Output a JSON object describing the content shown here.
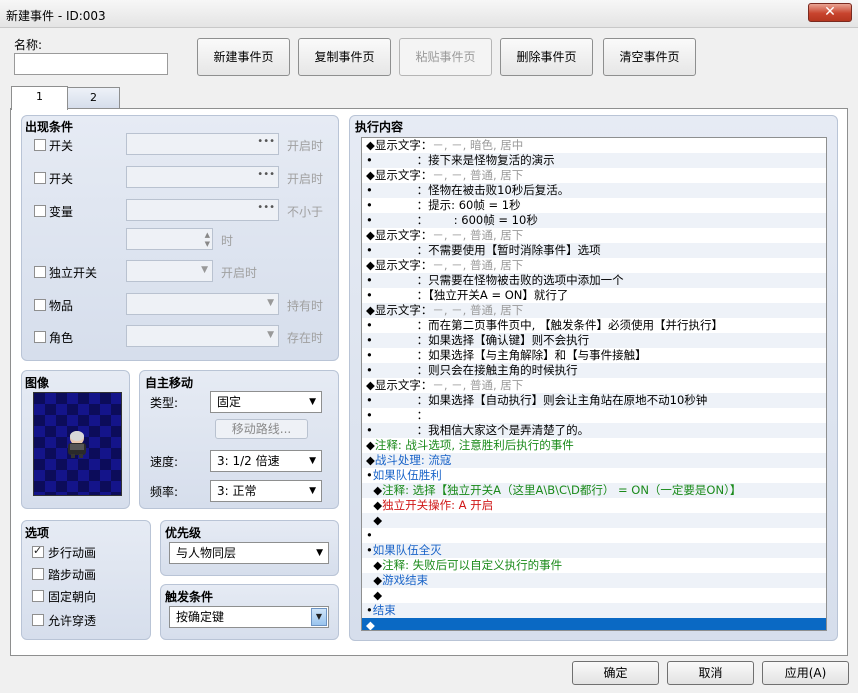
{
  "window": {
    "title": "新建事件 - ID:003",
    "close": "✕"
  },
  "name": {
    "label": "名称:",
    "value": ""
  },
  "toolbar": {
    "new_page": "新建事件页",
    "copy_page": "复制事件页",
    "paste_page": "粘贴事件页",
    "delete_page": "删除事件页",
    "clear_page": "清空事件页"
  },
  "tabs": [
    "1",
    "2"
  ],
  "conditions": {
    "title": "出现条件",
    "switch1": {
      "label": "开关",
      "suffix": "开启时"
    },
    "switch2": {
      "label": "开关",
      "suffix": "开启时"
    },
    "variable": {
      "label": "变量",
      "suffix": "不小于",
      "unit": "时"
    },
    "self_switch": {
      "label": "独立开关",
      "suffix": "开启时"
    },
    "item": {
      "label": "物品",
      "suffix": "持有时"
    },
    "actor": {
      "label": "角色",
      "suffix": "存在时"
    }
  },
  "image": {
    "title": "图像"
  },
  "autonomous": {
    "title": "自主移动",
    "type_label": "类型:",
    "type_value": "固定",
    "route_button": "移动路线...",
    "speed_label": "速度:",
    "speed_value": "3: 1/2 倍速",
    "freq_label": "频率:",
    "freq_value": "3: 正常"
  },
  "options": {
    "title": "选项",
    "items": [
      {
        "label": "步行动画",
        "checked": true
      },
      {
        "label": "踏步动画",
        "checked": false
      },
      {
        "label": "固定朝向",
        "checked": false
      },
      {
        "label": "允许穿透",
        "checked": false
      }
    ]
  },
  "priority": {
    "title": "优先级",
    "value": "与人物同层"
  },
  "trigger": {
    "title": "触发条件",
    "value": "按确定键"
  },
  "commands": {
    "title": "执行内容",
    "rows": [
      {
        "marker": "◆",
        "a": "显示文字：",
        "b": "－, －, 暗色, 居中",
        "color": "c-black",
        "bcolor": "c-gray"
      },
      {
        "marker": "•",
        "a": "            ：",
        "b": "接下来是怪物复活的演示",
        "color": "c-black",
        "bcolor": "c-black"
      },
      {
        "marker": "◆",
        "a": "显示文字：",
        "b": "－, －, 普通, 居下",
        "color": "c-black",
        "bcolor": "c-gray"
      },
      {
        "marker": "•",
        "a": "            ：",
        "b": "怪物在被击败10秒后复活。",
        "color": "c-black",
        "bcolor": "c-black"
      },
      {
        "marker": "•",
        "a": "            ：",
        "b": "提示: 60帧 = 1秒",
        "color": "c-black",
        "bcolor": "c-black"
      },
      {
        "marker": "•",
        "a": "            ：",
        "b": "       : 600帧 = 10秒",
        "color": "c-black",
        "bcolor": "c-black"
      },
      {
        "marker": "◆",
        "a": "显示文字：",
        "b": "－, －, 普通, 居下",
        "color": "c-black",
        "bcolor": "c-gray"
      },
      {
        "marker": "•",
        "a": "            ：",
        "b": "不需要使用【暂时消除事件】选项",
        "color": "c-black",
        "bcolor": "c-black"
      },
      {
        "marker": "◆",
        "a": "显示文字：",
        "b": "－, －, 普通, 居下",
        "color": "c-black",
        "bcolor": "c-gray"
      },
      {
        "marker": "•",
        "a": "            ：",
        "b": "只需要在怪物被击败的选项中添加一个",
        "color": "c-black",
        "bcolor": "c-black"
      },
      {
        "marker": "•",
        "a": "            ：",
        "b": "【独立开关A = ON】就行了",
        "color": "c-black",
        "bcolor": "c-black"
      },
      {
        "marker": "◆",
        "a": "显示文字：",
        "b": "－, －, 普通, 居下",
        "color": "c-black",
        "bcolor": "c-gray"
      },
      {
        "marker": "•",
        "a": "            ：",
        "b": "而在第二页事件页中, 【触发条件】必须使用【并行执行】",
        "color": "c-black",
        "bcolor": "c-black"
      },
      {
        "marker": "•",
        "a": "            ：",
        "b": "如果选择【确认键】则不会执行",
        "color": "c-black",
        "bcolor": "c-black"
      },
      {
        "marker": "•",
        "a": "            ：",
        "b": "如果选择【与主角解除】和【与事件接触】",
        "color": "c-black",
        "bcolor": "c-black"
      },
      {
        "marker": "•",
        "a": "            ：",
        "b": "则只会在接触主角的时候执行",
        "color": "c-black",
        "bcolor": "c-black"
      },
      {
        "marker": "◆",
        "a": "显示文字：",
        "b": "－, －, 普通, 居下",
        "color": "c-black",
        "bcolor": "c-gray"
      },
      {
        "marker": "•",
        "a": "            ：",
        "b": "如果选择【自动执行】则会让主角站在原地不动10秒钟",
        "color": "c-black",
        "bcolor": "c-black"
      },
      {
        "marker": "•",
        "a": "            ：",
        "b": "",
        "color": "c-black",
        "bcolor": "c-black"
      },
      {
        "marker": "•",
        "a": "            ：",
        "b": "我相信大家这个是弄清楚了的。",
        "color": "c-black",
        "bcolor": "c-black"
      },
      {
        "marker": "◆",
        "a": "注释: 战斗选项, 注意胜利后执行的事件",
        "b": "",
        "color": "c-green",
        "bcolor": "c-green"
      },
      {
        "marker": "◆",
        "a": "战斗处理: 流寇",
        "b": "",
        "color": "c-blue",
        "bcolor": "c-blue"
      },
      {
        "marker": "•",
        "a": "如果队伍胜利",
        "b": "",
        "color": "c-blue",
        "bcolor": "c-blue"
      },
      {
        "marker": "  ◆",
        "a": "注释: 选择【独立开关A（这里A\\B\\C\\D都行） = ON（一定要是ON）】",
        "b": "",
        "color": "c-green",
        "bcolor": "c-green"
      },
      {
        "marker": "  ◆",
        "a": "独立开关操作: A 开启",
        "b": "",
        "color": "c-red",
        "bcolor": "c-red"
      },
      {
        "marker": "  ◆",
        "a": "",
        "b": "",
        "color": "c-black",
        "bcolor": "c-black"
      },
      {
        "marker": "•",
        "a": "",
        "b": "",
        "color": "c-black",
        "bcolor": "c-black"
      },
      {
        "marker": "•",
        "a": "如果队伍全灭",
        "b": "",
        "color": "c-blue",
        "bcolor": "c-blue"
      },
      {
        "marker": "  ◆",
        "a": "注释: 失败后可以自定义执行的事件",
        "b": "",
        "color": "c-green",
        "bcolor": "c-green"
      },
      {
        "marker": "  ◆",
        "a": "游戏结束",
        "b": "",
        "color": "c-blue",
        "bcolor": "c-blue"
      },
      {
        "marker": "  ◆",
        "a": "",
        "b": "",
        "color": "c-black",
        "bcolor": "c-black"
      },
      {
        "marker": "•",
        "a": "结束",
        "b": "",
        "color": "c-blue",
        "bcolor": "c-blue"
      },
      {
        "marker": "◆",
        "a": "",
        "b": "",
        "color": "sel",
        "bcolor": "sel"
      }
    ]
  },
  "footer": {
    "ok": "确定",
    "cancel": "取消",
    "apply": "应用(A)"
  }
}
